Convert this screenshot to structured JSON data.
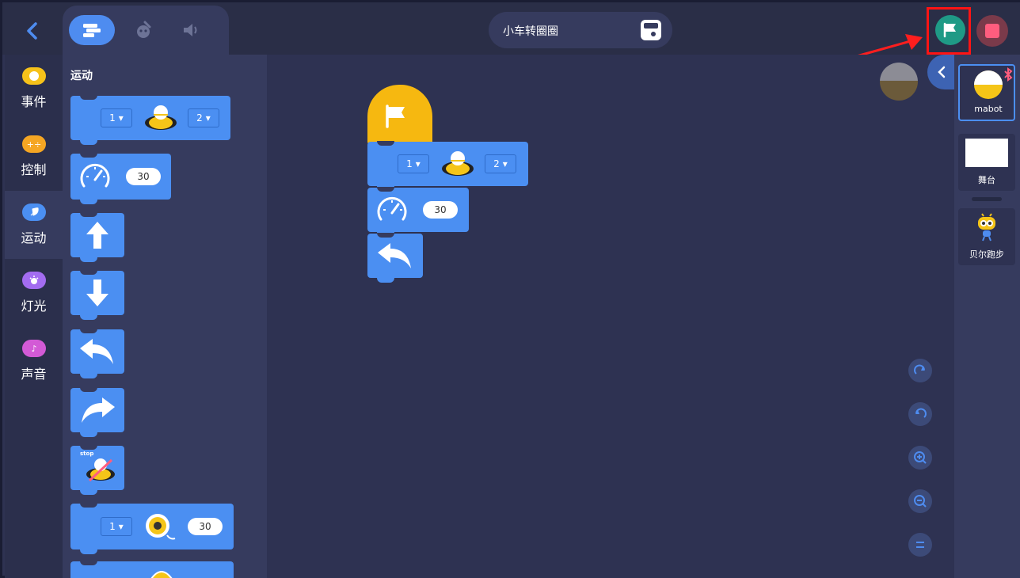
{
  "header": {
    "project_title": "小车转圈圈",
    "tabs": [
      {
        "name": "code-tab",
        "icon": "blocks-icon",
        "active": true
      },
      {
        "name": "costume-tab",
        "icon": "robot-paint-icon",
        "active": false
      },
      {
        "name": "sound-tab",
        "icon": "speaker-icon",
        "active": false
      }
    ],
    "run_button_color": "#1f9a86",
    "stop_button_color": "#ff5d7e"
  },
  "categories": [
    {
      "label": "事件",
      "color": "#f6c21a",
      "icon": "event-icon"
    },
    {
      "label": "控制",
      "color": "#f5a623",
      "icon": "control-icon"
    },
    {
      "label": "运动",
      "color": "#4b8ff2",
      "icon": "rocket-icon",
      "active": true
    },
    {
      "label": "灯光",
      "color": "#a36cf0",
      "icon": "light-icon"
    },
    {
      "label": "声音",
      "color": "#d35ad6",
      "icon": "music-note-icon"
    }
  ],
  "palette": {
    "title": "运动",
    "move_block": {
      "left_value": "1",
      "right_value": "2"
    },
    "speed_block": {
      "value": "30"
    },
    "stop_label": "stop",
    "motor_block": {
      "port": "1",
      "value": "30"
    }
  },
  "workspace": {
    "move_block": {
      "left_value": "1",
      "right_value": "2"
    },
    "speed_block": {
      "value": "30"
    }
  },
  "sprites": {
    "items": [
      {
        "name": "mabot"
      },
      {
        "name": "舞台"
      },
      {
        "name": "贝尔跑步"
      }
    ]
  }
}
